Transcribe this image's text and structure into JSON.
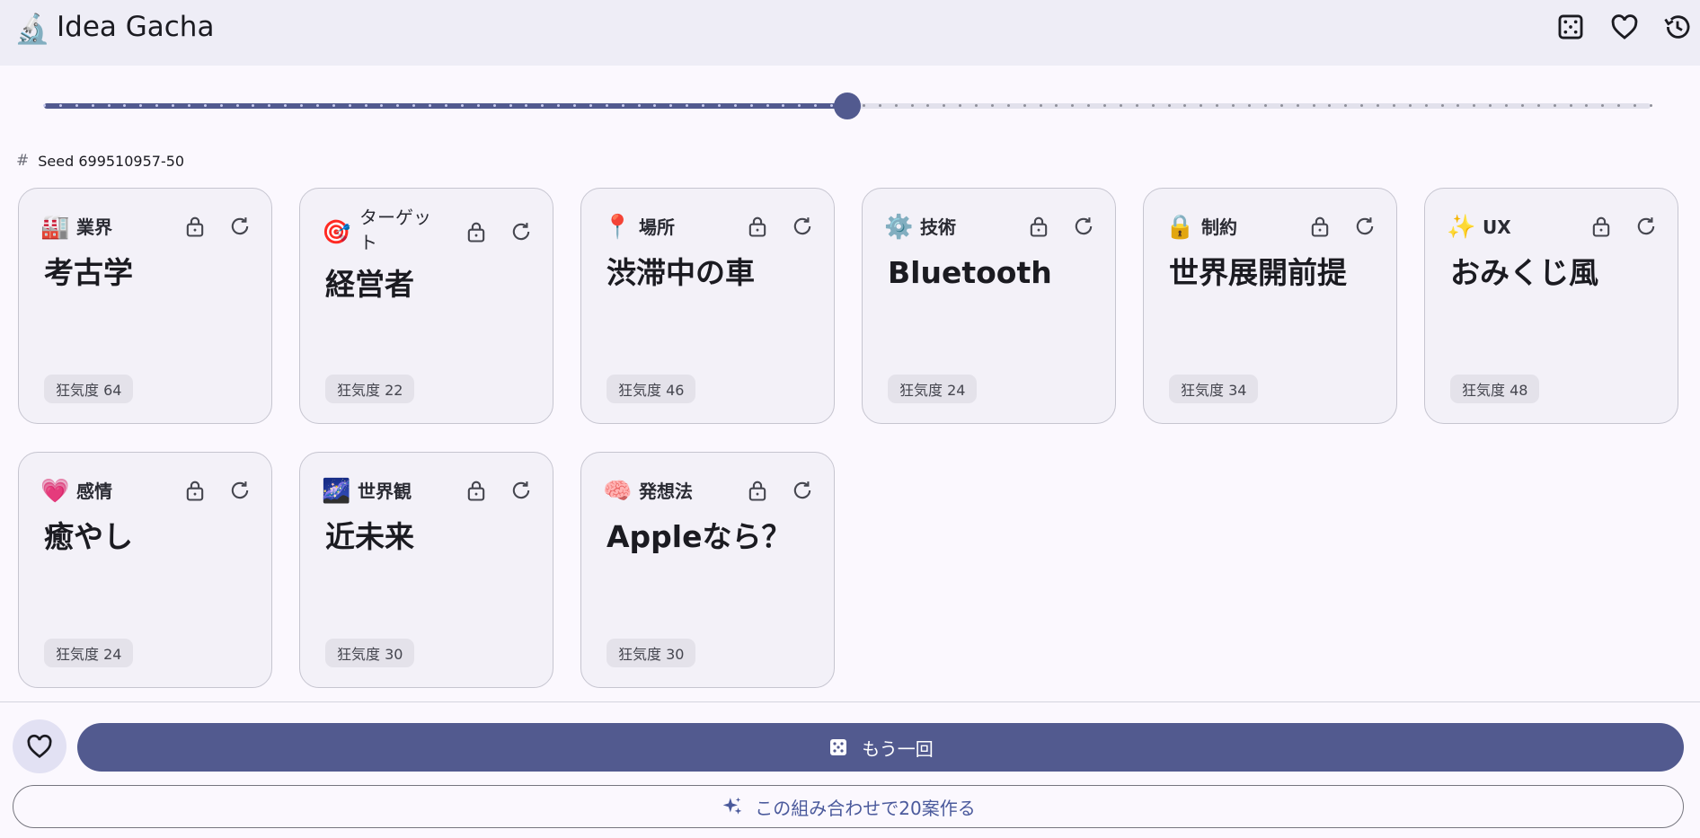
{
  "app": {
    "logo_emoji": "🔬",
    "title": "Idea Gacha",
    "icons": [
      "dice-icon",
      "heart-icon",
      "history-icon"
    ]
  },
  "slider": {
    "value_fraction": 0.5
  },
  "seed": {
    "label": "Seed 699510957-50"
  },
  "cards": [
    {
      "emoji": "🏭",
      "category": "業界",
      "value": "考古学",
      "badge": "狂気度 64"
    },
    {
      "emoji": "🎯",
      "category": "ターゲット",
      "value": "経営者",
      "badge": "狂気度 22"
    },
    {
      "emoji": "📍",
      "category": "場所",
      "value": "渋滞中の車",
      "badge": "狂気度 46"
    },
    {
      "emoji": "⚙️",
      "category": "技術",
      "value": "Bluetooth",
      "badge": "狂気度 24"
    },
    {
      "emoji": "🔒",
      "category": "制約",
      "value": "世界展開前提",
      "badge": "狂気度 34"
    },
    {
      "emoji": "✨",
      "category": "UX",
      "value": "おみくじ風",
      "badge": "狂気度 48"
    },
    {
      "emoji": "💗",
      "category": "感情",
      "value": "癒やし",
      "badge": "狂気度 24"
    },
    {
      "emoji": "🌌",
      "category": "世界観",
      "value": "近未来",
      "badge": "狂気度 30"
    },
    {
      "emoji": "🧠",
      "category": "発想法",
      "value": "Appleなら？",
      "badge": "狂気度 30"
    }
  ],
  "actions": {
    "again_label": "もう一回",
    "make20_label": "この組み合わせで20案作る"
  },
  "colors": {
    "primary": "#525a8f",
    "card_bg": "#f3f1f8",
    "appbar_bg": "#eeedf6"
  }
}
